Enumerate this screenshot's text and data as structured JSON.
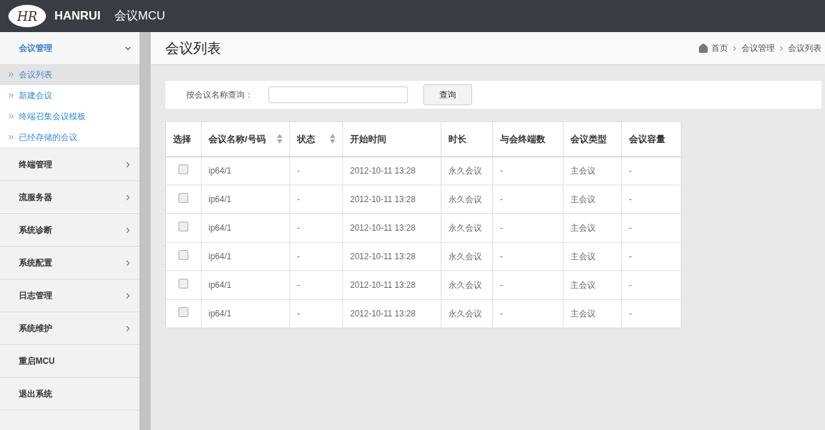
{
  "header": {
    "brand": "HANRUI",
    "logo_text": "HR",
    "app_title": "会议MCU"
  },
  "sidebar": {
    "items": [
      {
        "kind": "group",
        "label": "会议管理",
        "expanded": true,
        "children": [
          {
            "label": "会议列表",
            "selected": true
          },
          {
            "label": "新建会议",
            "selected": false
          },
          {
            "label": "终端召集会议模板",
            "selected": false
          },
          {
            "label": "已经存储的会议",
            "selected": false
          }
        ]
      },
      {
        "kind": "group",
        "label": "终端管理",
        "expanded": false
      },
      {
        "kind": "group",
        "label": "流服务器",
        "expanded": false
      },
      {
        "kind": "group",
        "label": "系统诊断",
        "expanded": false
      },
      {
        "kind": "group",
        "label": "系统配置",
        "expanded": false
      },
      {
        "kind": "group",
        "label": "日志管理",
        "expanded": false
      },
      {
        "kind": "group",
        "label": "系统维护",
        "expanded": false
      },
      {
        "kind": "link",
        "label": "重启MCU"
      },
      {
        "kind": "link",
        "label": "退出系统"
      }
    ]
  },
  "page": {
    "title": "会议列表",
    "breadcrumb": [
      "首页",
      "会议管理",
      "会议列表"
    ]
  },
  "search": {
    "label": "按会议名称查询：",
    "button": "查询"
  },
  "table": {
    "columns": [
      {
        "label": "选择",
        "sortable": false
      },
      {
        "label": "会议名称/号码",
        "sortable": true
      },
      {
        "label": "状态",
        "sortable": true
      },
      {
        "label": "开始时间",
        "sortable": false
      },
      {
        "label": "时长",
        "sortable": false
      },
      {
        "label": "与会终端数",
        "sortable": false
      },
      {
        "label": "会议类型",
        "sortable": false
      },
      {
        "label": "会议容量",
        "sortable": false
      }
    ],
    "rows": [
      {
        "checked": false,
        "cells": [
          "",
          "ip64/1",
          "-",
          "2012-10-11 13:28",
          "永久会议",
          "-",
          "主会议",
          "-"
        ]
      },
      {
        "checked": false,
        "cells": [
          "",
          "ip64/1",
          "-",
          "2012-10-11 13:28",
          "永久会议",
          "-",
          "主会议",
          "-"
        ]
      },
      {
        "checked": false,
        "cells": [
          "",
          "ip64/1",
          "-",
          "2012-10-11 13:28",
          "永久会议",
          "-",
          "主会议",
          "-"
        ]
      },
      {
        "checked": false,
        "cells": [
          "",
          "ip64/1",
          "-",
          "2012-10-11 13:28",
          "永久会议",
          "-",
          "主会议",
          "-"
        ]
      },
      {
        "checked": false,
        "cells": [
          "",
          "ip64/1",
          "-",
          "2012-10-11 13:28",
          "永久会议",
          "-",
          "主会议",
          "-"
        ]
      },
      {
        "checked": false,
        "cells": [
          "",
          "ip64/1",
          "-",
          "2012-10-11 13:28",
          "永久会议",
          "-",
          "主会议",
          "-"
        ]
      }
    ]
  }
}
